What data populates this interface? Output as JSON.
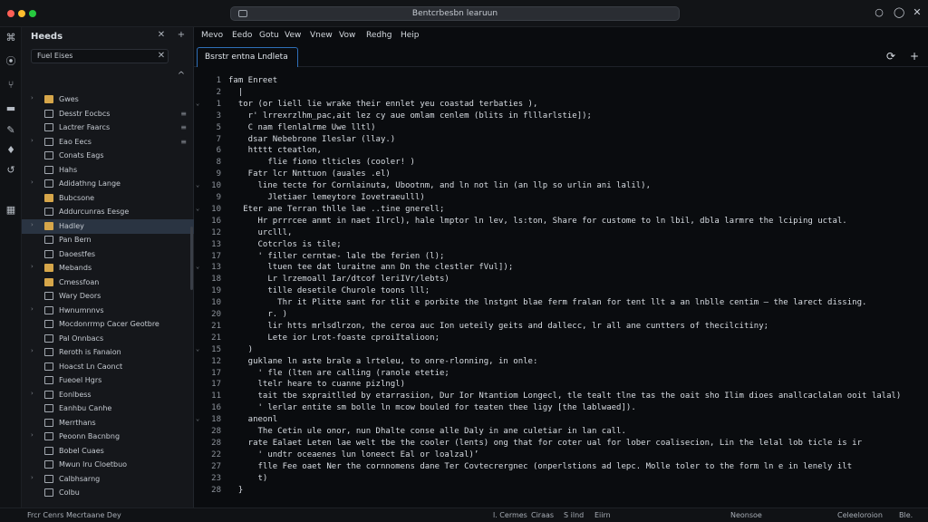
{
  "window": {
    "title": "Bentcrbesbn learuun"
  },
  "activity_bar": {
    "icons": [
      "explorer-icon",
      "search-icon",
      "source-control-icon",
      "chat-icon",
      "debug-icon",
      "extensions-icon",
      "settings-icon",
      "terminal-icon"
    ]
  },
  "sidebar": {
    "title": "Heeds",
    "search_value": "Fuel Eises",
    "items": [
      {
        "label": "Gwes",
        "kind": "folder",
        "badge": ""
      },
      {
        "label": "Desstr Eocbcs",
        "kind": "doc",
        "badge": "≡"
      },
      {
        "label": "Lactrer Faarcs",
        "kind": "doc",
        "badge": "≡"
      },
      {
        "label": "Eao Eecs",
        "kind": "doc",
        "badge": "≡"
      },
      {
        "label": "Conats Eags",
        "kind": "doc",
        "badge": ""
      },
      {
        "label": "Hahs",
        "kind": "doc",
        "badge": ""
      },
      {
        "label": "Adidathng Lange",
        "kind": "doc",
        "badge": ""
      },
      {
        "label": "Bubcsone",
        "kind": "folder",
        "badge": ""
      },
      {
        "label": "Addurcunras Eesge",
        "kind": "doc",
        "badge": ""
      },
      {
        "label": "Hadley",
        "kind": "folder",
        "badge": ""
      },
      {
        "label": "Pan Bern",
        "kind": "doc",
        "badge": ""
      },
      {
        "label": "Daoestfes",
        "kind": "doc",
        "badge": ""
      },
      {
        "label": "Mebands",
        "kind": "folder",
        "badge": ""
      },
      {
        "label": "Cmessfoan",
        "kind": "folder",
        "badge": ""
      },
      {
        "label": "Wary Deors",
        "kind": "doc",
        "badge": ""
      },
      {
        "label": "Hwnumnnvs",
        "kind": "doc",
        "badge": ""
      },
      {
        "label": "Mocdonrrmp Cacer Geotbre",
        "kind": "doc",
        "badge": ""
      },
      {
        "label": "Pal Onnbacs",
        "kind": "doc",
        "badge": ""
      },
      {
        "label": "Reroth is Fanaion",
        "kind": "doc",
        "badge": ""
      },
      {
        "label": "Hoacst Ln Caonct",
        "kind": "doc",
        "badge": ""
      },
      {
        "label": "Fueoel Hgrs",
        "kind": "doc",
        "badge": ""
      },
      {
        "label": "Eonlbess",
        "kind": "doc",
        "badge": ""
      },
      {
        "label": "Eanhbu Canhe",
        "kind": "doc",
        "badge": ""
      },
      {
        "label": "Merrthans",
        "kind": "doc",
        "badge": ""
      },
      {
        "label": "Peoonn Bacnbng",
        "kind": "doc",
        "badge": ""
      },
      {
        "label": "Bobel Cuaes",
        "kind": "doc",
        "badge": ""
      },
      {
        "label": "Mwun lru Cloetbuo",
        "kind": "doc",
        "badge": ""
      },
      {
        "label": "Calbhsarng",
        "kind": "doc",
        "badge": ""
      },
      {
        "label": "Colbu",
        "kind": "doc",
        "badge": ""
      }
    ]
  },
  "editor": {
    "menu": [
      "Mevo",
      "Eedo",
      "Gotu",
      "Vew",
      "Vnew",
      "Vow",
      "Redhg",
      "Heip"
    ],
    "tab_label": "Bsrstr entna Lndleta",
    "lines": [
      {
        "n": "1",
        "text": "fam Enreet"
      },
      {
        "n": "2",
        "text": "  |"
      },
      {
        "n": "1",
        "text": "  tor (or liell lie wrake their ennlet yeu coastad terbaties ),"
      },
      {
        "n": "3",
        "text": "    r' lrrexrzlhm_pac,ait lez cy aue omlam cenlem (blits in flllarlstie]);"
      },
      {
        "n": "5",
        "text": "    C nam flenlalrme Uwe lltl)"
      },
      {
        "n": "7",
        "text": "    dsar Nebebrone Ileslar (llay.)"
      },
      {
        "n": "6",
        "text": "    htttt cteatlon,"
      },
      {
        "n": "8",
        "text": "        flie fiono tlticles (cooler! )"
      },
      {
        "n": "9",
        "text": "    Fatr lcr Nnttuon (auales .el)"
      },
      {
        "n": "10",
        "text": "      line tecte for Cornlainuta, Ubootnm, and ln not lin (an llp so urlin ani lalil),"
      },
      {
        "n": "9",
        "text": "        Jletiaer lemeytore Iovetraeulll)"
      },
      {
        "n": "10",
        "text": "   Eter ane Terran thlle lae ..tine gnerell;"
      },
      {
        "n": "16",
        "text": "      Hr prrrcee anmt in naet Ilrcl), hale lmptor ln lev, ls:ton, Share for custome to ln lbil, dbla larmre the lciping uctal."
      },
      {
        "n": "12",
        "text": "      urclll,"
      },
      {
        "n": "13",
        "text": "      Cotcrlos is tile;"
      },
      {
        "n": "17",
        "text": "      ' filler cerntae- lale tbe ferien (l);"
      },
      {
        "n": "13",
        "text": "        ltuen tee dat luraitne ann Dn the clestler fVul]);"
      },
      {
        "n": "18",
        "text": "        Lr lrzemoall Iar/dtcof leriIVr/lebts)"
      },
      {
        "n": "19",
        "text": "        tille desetile Churole toons lll;"
      },
      {
        "n": "10",
        "text": "          Thr it Plitte sant for tlit e porbite the lnstgnt blae ferm fralan for tent llt a an lnblle centim — the larect dissing."
      },
      {
        "n": "20",
        "text": "        r. )"
      },
      {
        "n": "21",
        "text": "        lir htts mrlsdlrzon, the ceroa auc Ion ueteily geits and dallecc, lr all ane cuntters of thecilcitiny;"
      },
      {
        "n": "21",
        "text": "        Lete ior Lrot-foaste cproiItalioon;"
      },
      {
        "n": "15",
        "text": "    )"
      },
      {
        "n": "12",
        "text": "    guklane ln aste brale a lrteleu, to onre-rlonning, in onle:"
      },
      {
        "n": "17",
        "text": "      ' fle (lten are calling (ranole etetie;"
      },
      {
        "n": "17",
        "text": "      ltelr heare to cuanne pizlngl)"
      },
      {
        "n": "11",
        "text": "      tait tbe sxpraitlled by etarrasiion, Dur Ior Ntantiom Longecl, tle tealt tlne tas the oait sho Ilim dioes anallcaclalan ooit lalal)"
      },
      {
        "n": "16",
        "text": "      ' lerlar entite sm bolle ln mcow bouled for teaten thee ligy [the lablwaed])."
      },
      {
        "n": "18",
        "text": "    aneonl"
      },
      {
        "n": "28",
        "text": "      The Cetin ule onor, nun Dhalte conse alle Daly in ane culetiar in lan call."
      },
      {
        "n": "28",
        "text": "    rate Ealaet Leten lae welt tbe the cooler (lents) ong that for coter ual for lober coalisecion, Lin the lelal lob ticle is ir"
      },
      {
        "n": "22",
        "text": "      ' undtr oceaenes lun loneect Eal or loalzal)’"
      },
      {
        "n": "27",
        "text": "      flle Fee oaet Ner the cornnomens dane Ter Covtecrergnec (onperlstions ad lepc. Molle toler to the form ln e in lenely ilt"
      },
      {
        "n": "23",
        "text": "      t)"
      },
      {
        "n": "28",
        "text": "  }"
      }
    ]
  },
  "status": {
    "left": "Frcr  Cenrs  Mecrtaane Dey",
    "mid_items": [
      "l. Cermes",
      "Ciraas",
      "S ilnd",
      "Eiirn"
    ],
    "right": "Neonsoe",
    "far_right": "Celeeloroion",
    "end": "Ble."
  }
}
